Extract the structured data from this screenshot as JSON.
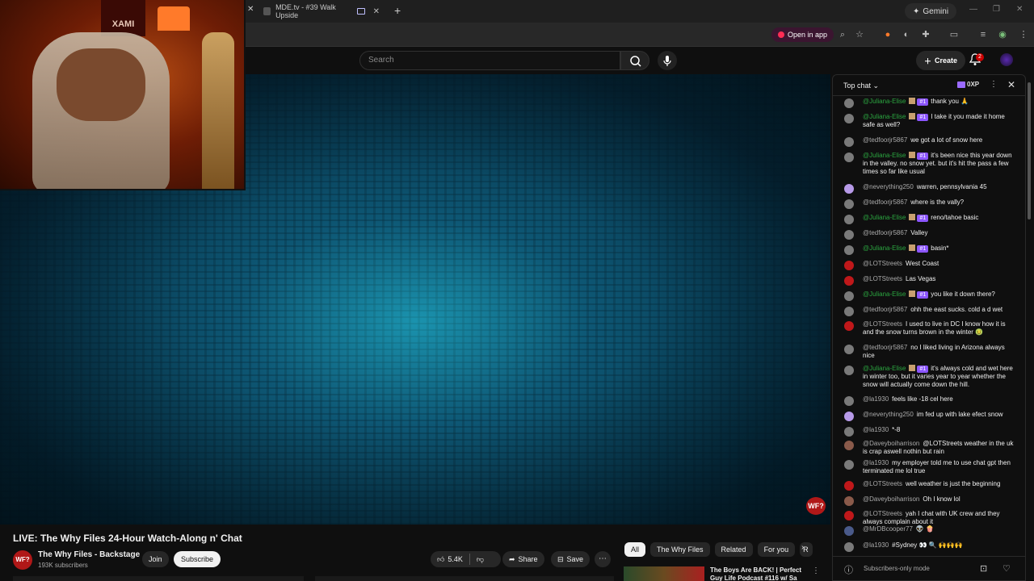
{
  "browser": {
    "tab_title": "MDE.tv - #39 Walk Upside",
    "gemini_label": "Gemini",
    "open_in_app": "Open in app"
  },
  "yt": {
    "search_placeholder": "Search",
    "create_label": "Create",
    "notif_count": "2"
  },
  "video": {
    "title": "LIVE: The Why Files 24-Hour Watch-Along n' Chat",
    "watermark": "WF?"
  },
  "webcam": {
    "poster_text": "XAMI"
  },
  "channel": {
    "name": "The Why Files - Backstage",
    "subscribers": "193K subscribers",
    "avatar_text": "WF?",
    "join_label": "Join",
    "subscribe_label": "Subscribe"
  },
  "actions": {
    "likes": "5.4K",
    "share_label": "Share",
    "save_label": "Save"
  },
  "filters": [
    "All",
    "The Why Files",
    "Related",
    "For you",
    "R"
  ],
  "suggested": {
    "title": "The Boys Are BACK! | Perfect Guy Life Podcast #116 w/ Sa"
  },
  "chat": {
    "header": "Top chat",
    "xp": "0XP",
    "footer": "Subscribers-only mode",
    "badge_text": "#1",
    "messages": [
      {
        "author": "@Juliana-Elise",
        "badge": true,
        "avatar": "gray",
        "text": "thank you 🙏"
      },
      {
        "author": "@Juliana-Elise",
        "badge": true,
        "avatar": "gray",
        "text": "I take it you made it home safe as well?"
      },
      {
        "author": "@tedfoorjr5867",
        "badge": false,
        "avatar": "gray",
        "text": "we got a lot of snow here"
      },
      {
        "author": "@Juliana-Elise",
        "badge": true,
        "avatar": "gray",
        "text": "it's been nice this year down in the valley. no snow yet. but it's hit the pass a few times so far like usual"
      },
      {
        "author": "@neverything250",
        "badge": false,
        "avatar": "lilac",
        "text": "warren, pennsylvania 45"
      },
      {
        "author": "@tedfoorjr5867",
        "badge": false,
        "avatar": "gray",
        "text": "where is the vally?"
      },
      {
        "author": "@Juliana-Elise",
        "badge": true,
        "avatar": "gray",
        "text": "reno/tahoe basic"
      },
      {
        "author": "@tedfoorjr5867",
        "badge": false,
        "avatar": "gray",
        "text": "Valley"
      },
      {
        "author": "@Juliana-Elise",
        "badge": true,
        "avatar": "gray",
        "text": "basin*"
      },
      {
        "author": "@LOTStreets",
        "badge": false,
        "avatar": "red",
        "text": "West Coast"
      },
      {
        "author": "@LOTStreets",
        "badge": false,
        "avatar": "red",
        "text": "Las Vegas"
      },
      {
        "author": "@Juliana-Elise",
        "badge": true,
        "avatar": "gray",
        "text": "you like it down there?"
      },
      {
        "author": "@tedfoorjr5867",
        "badge": false,
        "avatar": "gray",
        "text": "ohh the east sucks. cold a d wet"
      },
      {
        "author": "@LOTStreets",
        "badge": false,
        "avatar": "red",
        "text": "I used to live in DC I know how it is and the snow turns brown in the winter 🤢"
      },
      {
        "author": "@tedfoorjr5867",
        "badge": false,
        "avatar": "gray",
        "text": "no I liked living in Arizona always nice"
      },
      {
        "author": "@Juliana-Elise",
        "badge": true,
        "avatar": "gray",
        "text": "it's always cold and wet here in winter too, but it varies year to year whether the snow will actually come down the hill."
      },
      {
        "author": "@la1930",
        "badge": false,
        "avatar": "gray",
        "text": "feels like -18 cel here"
      },
      {
        "author": "@neverything250",
        "badge": false,
        "avatar": "lilac",
        "text": "im fed up with lake efect snow"
      },
      {
        "author": "@la1930",
        "badge": false,
        "avatar": "gray",
        "text": "*-8"
      },
      {
        "author": "@Daveyboiharrison",
        "badge": false,
        "avatar": "brown",
        "text": "@LOTStreets weather in the uk is crap aswell nothin but rain"
      },
      {
        "author": "@la1930",
        "badge": false,
        "avatar": "gray",
        "text": "my employer told me to use chat gpt then terminated me lol true"
      },
      {
        "author": "@LOTStreets",
        "badge": false,
        "avatar": "red",
        "text": "well weather is just the beginning"
      },
      {
        "author": "@Daveyboiharrison",
        "badge": false,
        "avatar": "brown",
        "text": "Oh I know lol"
      },
      {
        "author": "@LOTStreets",
        "badge": false,
        "avatar": "red",
        "text": "yah I chat with UK crew and they always complain about it"
      },
      {
        "author": "@MrDBcooper77",
        "badge": false,
        "avatar": "blue",
        "text": "👽 🍿"
      },
      {
        "author": "@la1930",
        "badge": false,
        "avatar": "gray",
        "text": "#Sydney 👀 🔍 🙌🙌🙌"
      }
    ]
  }
}
